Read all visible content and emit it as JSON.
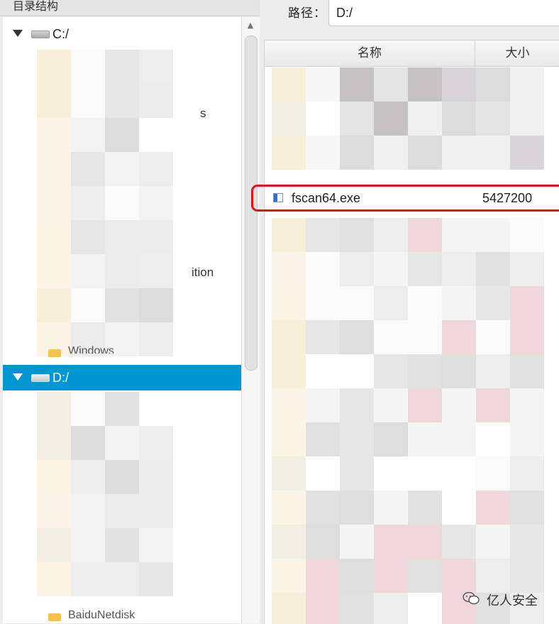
{
  "tree_panel": {
    "title": "目录结构",
    "drives": [
      {
        "label": "C:/",
        "expanded": true,
        "selected": false
      },
      {
        "label": "D:/",
        "expanded": true,
        "selected": true
      }
    ],
    "visible_fragments": [
      "s",
      "ition",
      "Windows",
      "BaiduNetdisk"
    ]
  },
  "path_bar": {
    "label": "路径：",
    "value": "D:/"
  },
  "file_table": {
    "columns": [
      "名称",
      "大小"
    ],
    "highlighted_row": {
      "name": "fscan64.exe",
      "size": "5427200"
    }
  },
  "watermark": {
    "text": "亿人安全",
    "icon": "wechat-icon"
  },
  "colors": {
    "selection": "#0096d2",
    "highlight_border": "#e0141e"
  }
}
